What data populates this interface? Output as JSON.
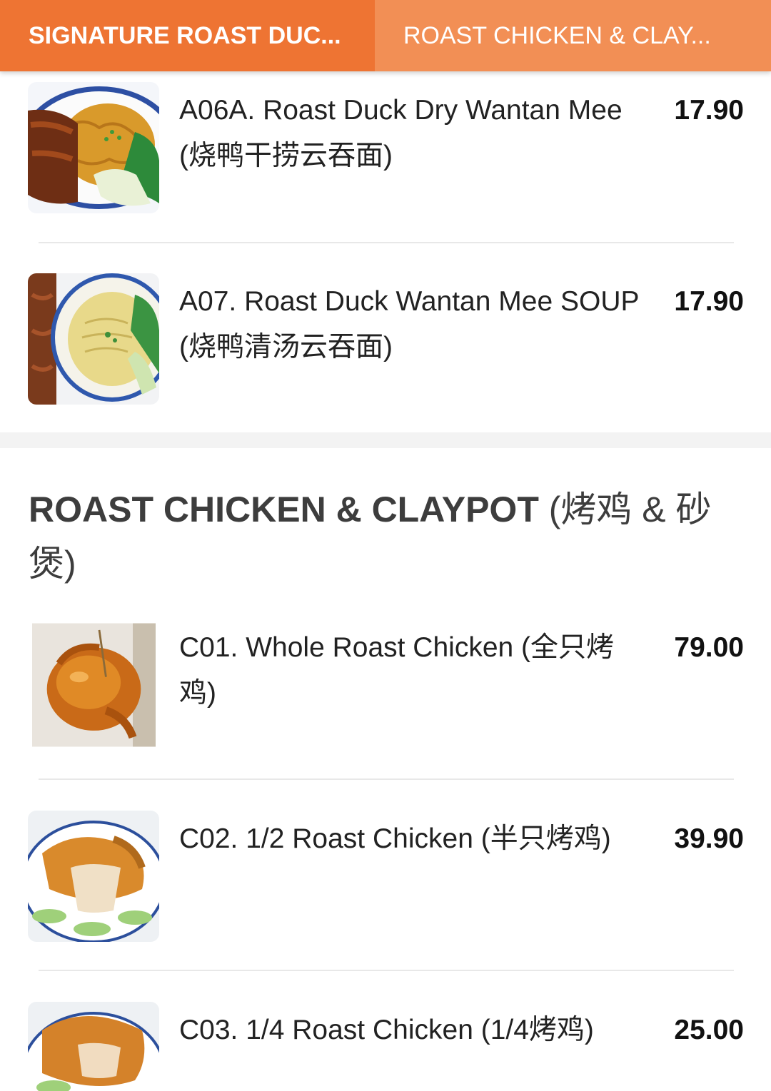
{
  "tabs": [
    {
      "label": "SIGNATURE ROAST DUC...",
      "active": true
    },
    {
      "label": "ROAST CHICKEN & CLAY...",
      "active": false
    }
  ],
  "colors": {
    "tab_active": "#ee7433",
    "tab_inactive": "#f28f55",
    "section_gap": "#f3f3f3"
  },
  "items_top": [
    {
      "name": "A06A. Roast Duck Dry Wantan Mee (烧鸭干捞云吞面)",
      "price": "17.90",
      "image": "roast-duck-dry-noodle-photo"
    },
    {
      "name": "A07. Roast Duck Wantan Mee SOUP (烧鸭清汤云吞面)",
      "price": "17.90",
      "image": "roast-duck-soup-noodle-photo"
    }
  ],
  "section": {
    "title_en": "ROAST CHICKEN & CLAYPOT ",
    "title_cn": "(烤鸡 & 砂煲)"
  },
  "items_bottom": [
    {
      "name": "C01. Whole Roast Chicken (全只烤鸡)",
      "price": "79.00",
      "image": "whole-roast-chicken-photo"
    },
    {
      "name": "C02. 1/2 Roast Chicken (半只烤鸡)",
      "price": "39.90",
      "image": "half-roast-chicken-photo"
    },
    {
      "name": "C03. 1/4 Roast Chicken (1/4烤鸡)",
      "price": "25.00",
      "image": "quarter-roast-chicken-photo"
    }
  ]
}
